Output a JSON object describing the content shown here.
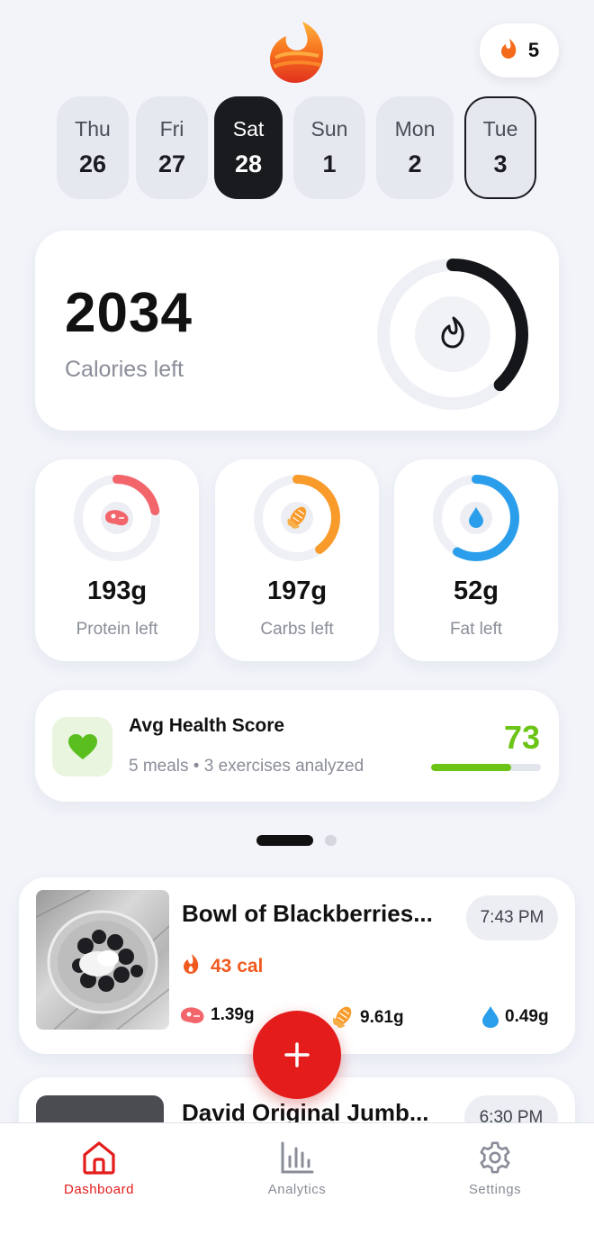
{
  "header": {
    "streak_count": "5",
    "streak_icon": "flame-icon"
  },
  "days": [
    {
      "name": "Thu",
      "date": "26",
      "state": "normal"
    },
    {
      "name": "Fri",
      "date": "27",
      "state": "normal"
    },
    {
      "name": "Sat",
      "date": "28",
      "state": "selected"
    },
    {
      "name": "Sun",
      "date": "1",
      "state": "normal"
    },
    {
      "name": "Mon",
      "date": "2",
      "state": "normal"
    },
    {
      "name": "Tue",
      "date": "3",
      "state": "today"
    }
  ],
  "calories": {
    "value": "2034",
    "label": "Calories left",
    "progress": 0.38
  },
  "macros": [
    {
      "value": "193g",
      "label": "Protein left",
      "icon": "steak-icon",
      "color": "#F2656B",
      "progress": 0.22
    },
    {
      "value": "197g",
      "label": "Carbs left",
      "icon": "corn-icon",
      "color": "#F99B2A",
      "progress": 0.4
    },
    {
      "value": "52g",
      "label": "Fat left",
      "icon": "water-drop-icon",
      "color": "#2B9EEB",
      "progress": 0.58
    }
  ],
  "health": {
    "title": "Avg Health Score",
    "subtitle": "5 meals • 3 exercises analyzed",
    "score": "73",
    "progress": 0.73,
    "color": "#6CC417"
  },
  "meals": [
    {
      "title": "Bowl of Blackberries...",
      "time": "7:43 PM",
      "calories": "43 cal",
      "protein": "1.39g",
      "carbs": "9.61g",
      "fat": "0.49g"
    },
    {
      "title": "David Original Jumb...",
      "time": "6:30 PM"
    }
  ],
  "tabs": [
    {
      "label": "Dashboard",
      "icon": "home-icon",
      "active": true
    },
    {
      "label": "Analytics",
      "icon": "bar-chart-icon",
      "active": false
    },
    {
      "label": "Settings",
      "icon": "gear-icon",
      "active": false
    }
  ],
  "colors": {
    "accent": "#E41C1C",
    "calorie_orange": "#F05A1E"
  }
}
